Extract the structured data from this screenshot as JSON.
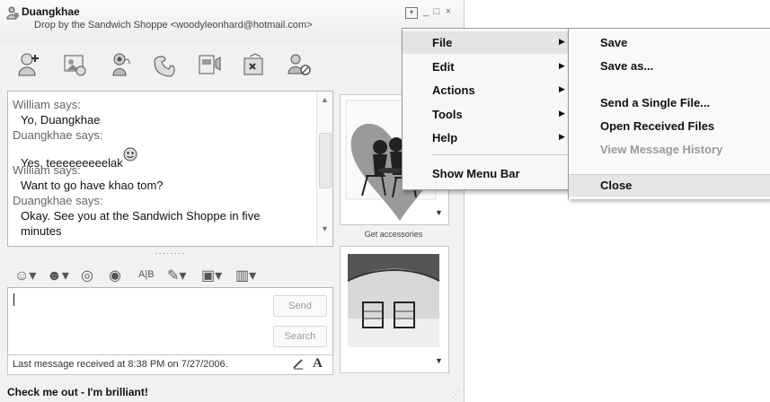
{
  "window": {
    "contact_name": "Duangkhae",
    "status_message": "Drop by the Sandwich Shoppe <woodyleonhard@hotmail.com>",
    "controls": [
      "menu",
      "minimize",
      "maximize",
      "close"
    ]
  },
  "toolbar": {
    "icons": [
      "invite-contact-icon",
      "share-files-icon",
      "video-call-icon",
      "call-icon",
      "activities-icon",
      "games-icon",
      "block-icon"
    ]
  },
  "conversation": {
    "lines": [
      {
        "type": "sender",
        "text": "William says:"
      },
      {
        "type": "message",
        "text": "Yo, Duangkhae"
      },
      {
        "type": "sender",
        "text": "Duangkhae says:"
      },
      {
        "type": "message",
        "text": "Yes, teeeeeeeeelak"
      },
      {
        "type": "sender",
        "text": "William says:"
      },
      {
        "type": "message",
        "text": "Want to go have khao tom?"
      },
      {
        "type": "sender",
        "text": "Duangkhae says:"
      },
      {
        "type": "message",
        "text": "Okay. See you at the Sandwich Shoppe in five"
      },
      {
        "type": "message",
        "text": "minutes"
      }
    ]
  },
  "compose": {
    "send_label": "Send",
    "search_label": "Search"
  },
  "statusbar": {
    "text": "Last message received at 8:38 PM on 7/27/2006.",
    "font_label": "A"
  },
  "personal_message": "Check me out - I'm brilliant!",
  "sidebar": {
    "get_accessories": "Get accessories"
  },
  "menu": {
    "items": [
      {
        "label": "File",
        "submenu": true,
        "highlighted": true
      },
      {
        "label": "Edit",
        "submenu": true
      },
      {
        "label": "Actions",
        "submenu": true
      },
      {
        "label": "Tools",
        "submenu": true
      },
      {
        "label": "Help",
        "submenu": true
      },
      {
        "label": "Show Menu Bar",
        "submenu": false
      }
    ],
    "arrow_glyph": "▶",
    "file_submenu": [
      {
        "label": "Save"
      },
      {
        "label": "Save as..."
      },
      {
        "label": "Send a Single File..."
      },
      {
        "label": "Open Received Files"
      },
      {
        "label": "View Message History",
        "disabled": true
      },
      {
        "label": "Close",
        "highlighted": true
      }
    ]
  }
}
